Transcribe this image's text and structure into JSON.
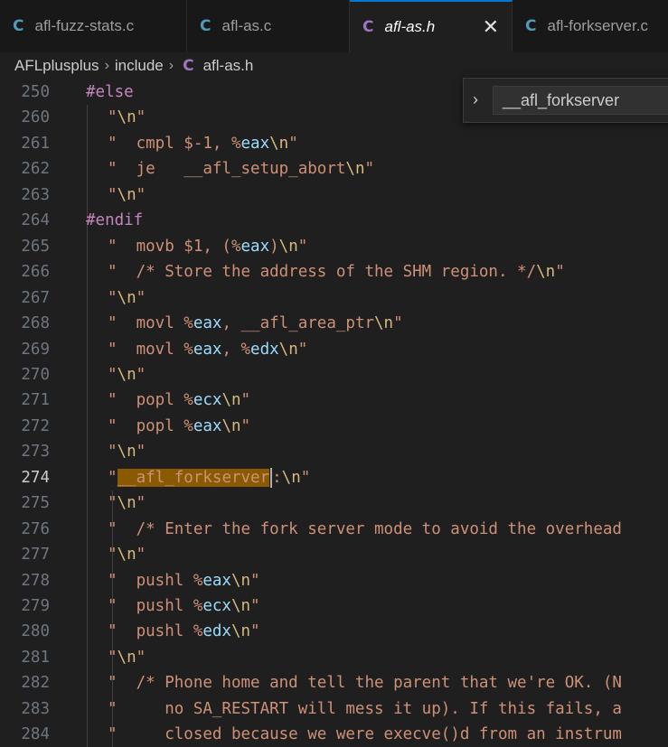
{
  "tabs": [
    {
      "icon": "C",
      "label": "afl-fuzz-stats.c",
      "icon_color": "#519aba"
    },
    {
      "icon": "C",
      "label": "afl-as.c",
      "icon_color": "#519aba"
    },
    {
      "icon": "C",
      "label": "afl-as.h",
      "icon_color": "#a074c4",
      "close": "✕"
    },
    {
      "icon": "C",
      "label": "afl-forkserver.c",
      "icon_color": "#519aba"
    }
  ],
  "breadcrumb": {
    "root": "AFLplusplus",
    "folder": "include",
    "icon": "C",
    "file": "afl-as.h"
  },
  "find": {
    "chevron": "›",
    "value": "__afl_forkserver"
  },
  "lines": [
    {
      "num": "250",
      "text": "#else",
      "kind": "kw"
    },
    {
      "num": "260",
      "text": "\"\\n\""
    },
    {
      "num": "261",
      "text": "\"  cmpl $-1, %eax\\n\""
    },
    {
      "num": "262",
      "text": "\"  je   __afl_setup_abort\\n\""
    },
    {
      "num": "263",
      "text": "\"\\n\""
    },
    {
      "num": "264",
      "text": "#endif",
      "kind": "kw"
    },
    {
      "num": "265",
      "text": "\"  movb $1, (%eax)\\n\""
    },
    {
      "num": "266",
      "text": "\"  /* Store the address of the SHM region. */\\n\""
    },
    {
      "num": "267",
      "text": "\"\\n\""
    },
    {
      "num": "268",
      "text": "\"  movl %eax, __afl_area_ptr\\n\""
    },
    {
      "num": "269",
      "text": "\"  movl %eax, %edx\\n\""
    },
    {
      "num": "270",
      "text": "\"\\n\""
    },
    {
      "num": "271",
      "text": "\"  popl %ecx\\n\""
    },
    {
      "num": "272",
      "text": "\"  popl %eax\\n\""
    },
    {
      "num": "273",
      "text": "\"\\n\""
    },
    {
      "num": "274",
      "text": "\"__afl_forkserver:\\n\"",
      "current": true
    },
    {
      "num": "275",
      "text": "\"\\n\""
    },
    {
      "num": "276",
      "text": "\"  /* Enter the fork server mode to avoid the overhead"
    },
    {
      "num": "277",
      "text": "\"\\n\""
    },
    {
      "num": "278",
      "text": "\"  pushl %eax\\n\""
    },
    {
      "num": "279",
      "text": "\"  pushl %ecx\\n\""
    },
    {
      "num": "280",
      "text": "\"  pushl %edx\\n\""
    },
    {
      "num": "281",
      "text": "\"\\n\""
    },
    {
      "num": "282",
      "text": "\"  /* Phone home and tell the parent that we're OK. (N"
    },
    {
      "num": "283",
      "text": "\"     no SA_RESTART will mess it up). If this fails, a"
    },
    {
      "num": "284",
      "text": "\"     closed because we were execve()d from an instrum"
    }
  ],
  "colors": {
    "string": "#ce9178",
    "keyword": "#c586c0",
    "register": "#9cdcfe",
    "escape": "#d7ba7d",
    "highlight": "#8a5a00",
    "accent": "#0078d4"
  }
}
